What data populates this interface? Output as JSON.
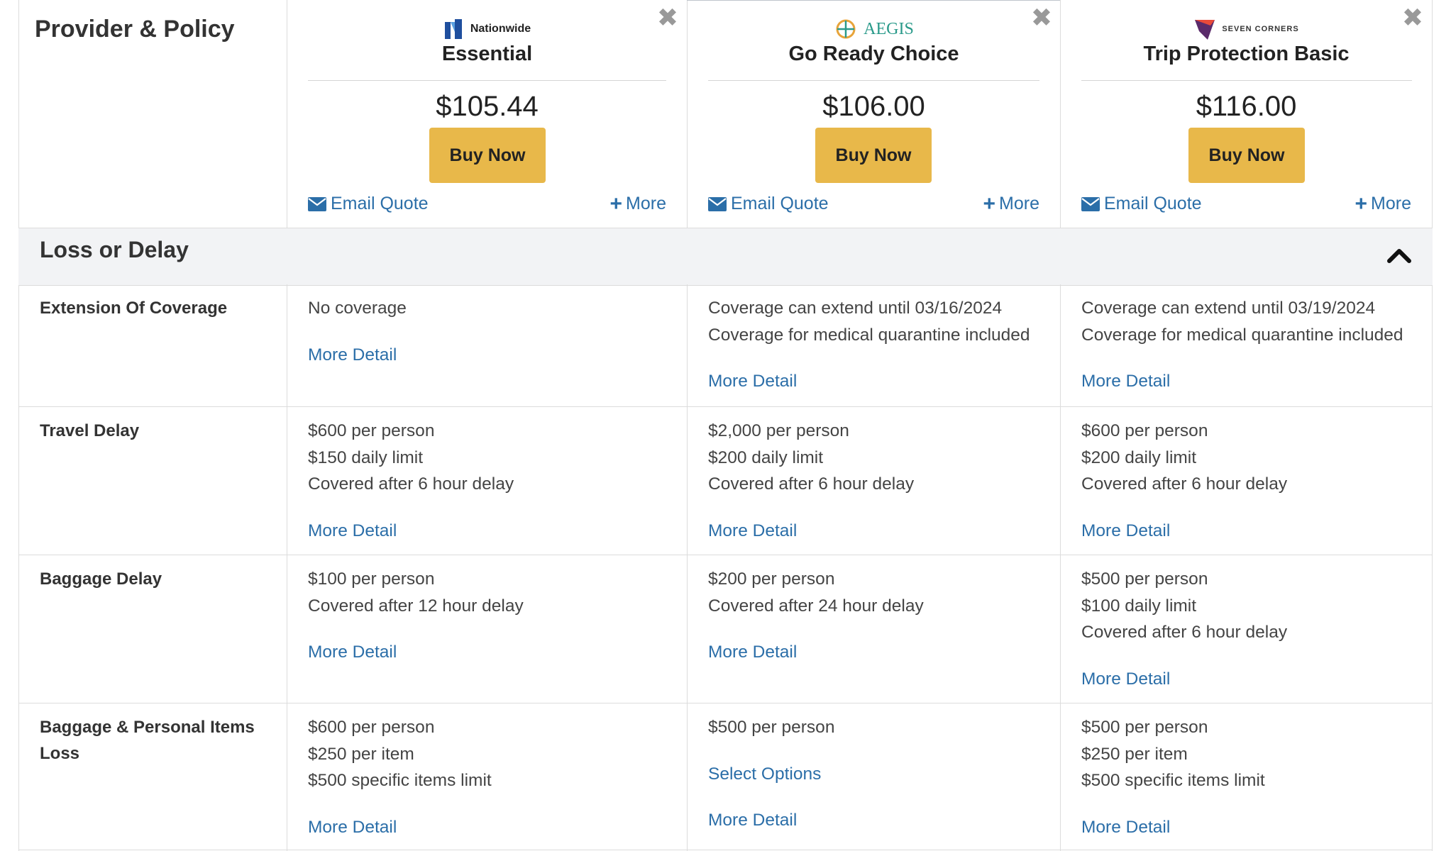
{
  "header": {
    "title": "Provider & Policy"
  },
  "plans": [
    {
      "logo_text": "Nationwide",
      "name": "Essential",
      "price": "$105.44",
      "buy_label": "Buy Now",
      "email_label": "Email Quote",
      "more_label": "More",
      "close_icon": "close-icon"
    },
    {
      "logo_text": "AEGIS",
      "name": "Go Ready Choice",
      "price": "$106.00",
      "buy_label": "Buy Now",
      "email_label": "Email Quote",
      "more_label": "More",
      "close_icon": "close-icon"
    },
    {
      "logo_text": "SEVEN CORNERS",
      "name": "Trip Protection Basic",
      "price": "$116.00",
      "buy_label": "Buy Now",
      "email_label": "Email Quote",
      "more_label": "More",
      "close_icon": "close-icon"
    }
  ],
  "section": {
    "title": "Loss or Delay",
    "toggle_icon": "chevron-up-icon"
  },
  "rows": [
    {
      "label": "Extension Of Coverage",
      "cells": [
        {
          "lines": [
            "No coverage"
          ],
          "link": "More Detail"
        },
        {
          "lines": [
            "Coverage can extend until 03/16/2024",
            "Coverage for medical quarantine included"
          ],
          "link": "More Detail"
        },
        {
          "lines": [
            "Coverage can extend until 03/19/2024",
            "Coverage for medical quarantine included"
          ],
          "link": "More Detail"
        }
      ]
    },
    {
      "label": "Travel Delay",
      "cells": [
        {
          "lines": [
            "$600 per person",
            "$150 daily limit",
            "Covered after 6 hour delay"
          ],
          "link": "More Detail"
        },
        {
          "lines": [
            "$2,000 per person",
            "$200 daily limit",
            "Covered after 6 hour delay"
          ],
          "link": "More Detail"
        },
        {
          "lines": [
            "$600 per person",
            "$200 daily limit",
            "Covered after 6 hour delay"
          ],
          "link": "More Detail"
        }
      ]
    },
    {
      "label": "Baggage Delay",
      "cells": [
        {
          "lines": [
            "$100 per person",
            "Covered after 12 hour delay"
          ],
          "link": "More Detail"
        },
        {
          "lines": [
            "$200 per person",
            "Covered after 24 hour delay"
          ],
          "link": "More Detail"
        },
        {
          "lines": [
            "$500 per person",
            "$100 daily limit",
            "Covered after 6 hour delay"
          ],
          "link": "More Detail"
        }
      ]
    },
    {
      "label_line1": "Baggage & Personal Items",
      "label_line2": "Loss",
      "cells": [
        {
          "lines": [
            "$600 per person",
            "$250 per item",
            "$500 specific items limit"
          ],
          "link": "More Detail"
        },
        {
          "lines": [
            "$500 per person"
          ],
          "select_link": "Select Options",
          "link": "More Detail"
        },
        {
          "lines": [
            "$500 per person",
            "$250 per item",
            "$500 specific items limit"
          ],
          "link": "More Detail"
        }
      ]
    }
  ],
  "colors": {
    "accent_button": "#e8b84a",
    "link": "#2b6ea8",
    "section_bg": "#f2f3f5"
  }
}
